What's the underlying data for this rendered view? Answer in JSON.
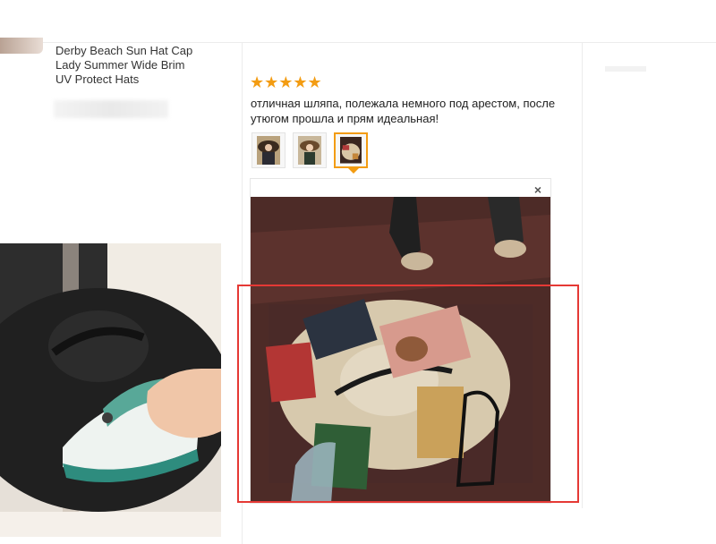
{
  "product": {
    "title_lines": [
      "Derby Beach Sun Hat Cap",
      "Lady Summer Wide Brim",
      "UV Protect Hats"
    ]
  },
  "review": {
    "rating": 5,
    "stars": "★★★★★",
    "text": "отличная шляпа, полежала немного под арестом, после утюгом прошла и прям идеальная!",
    "selected_thumbnail": 3,
    "close_label": "×"
  },
  "colors": {
    "star": "#f39c12",
    "highlight": "#e53935"
  }
}
